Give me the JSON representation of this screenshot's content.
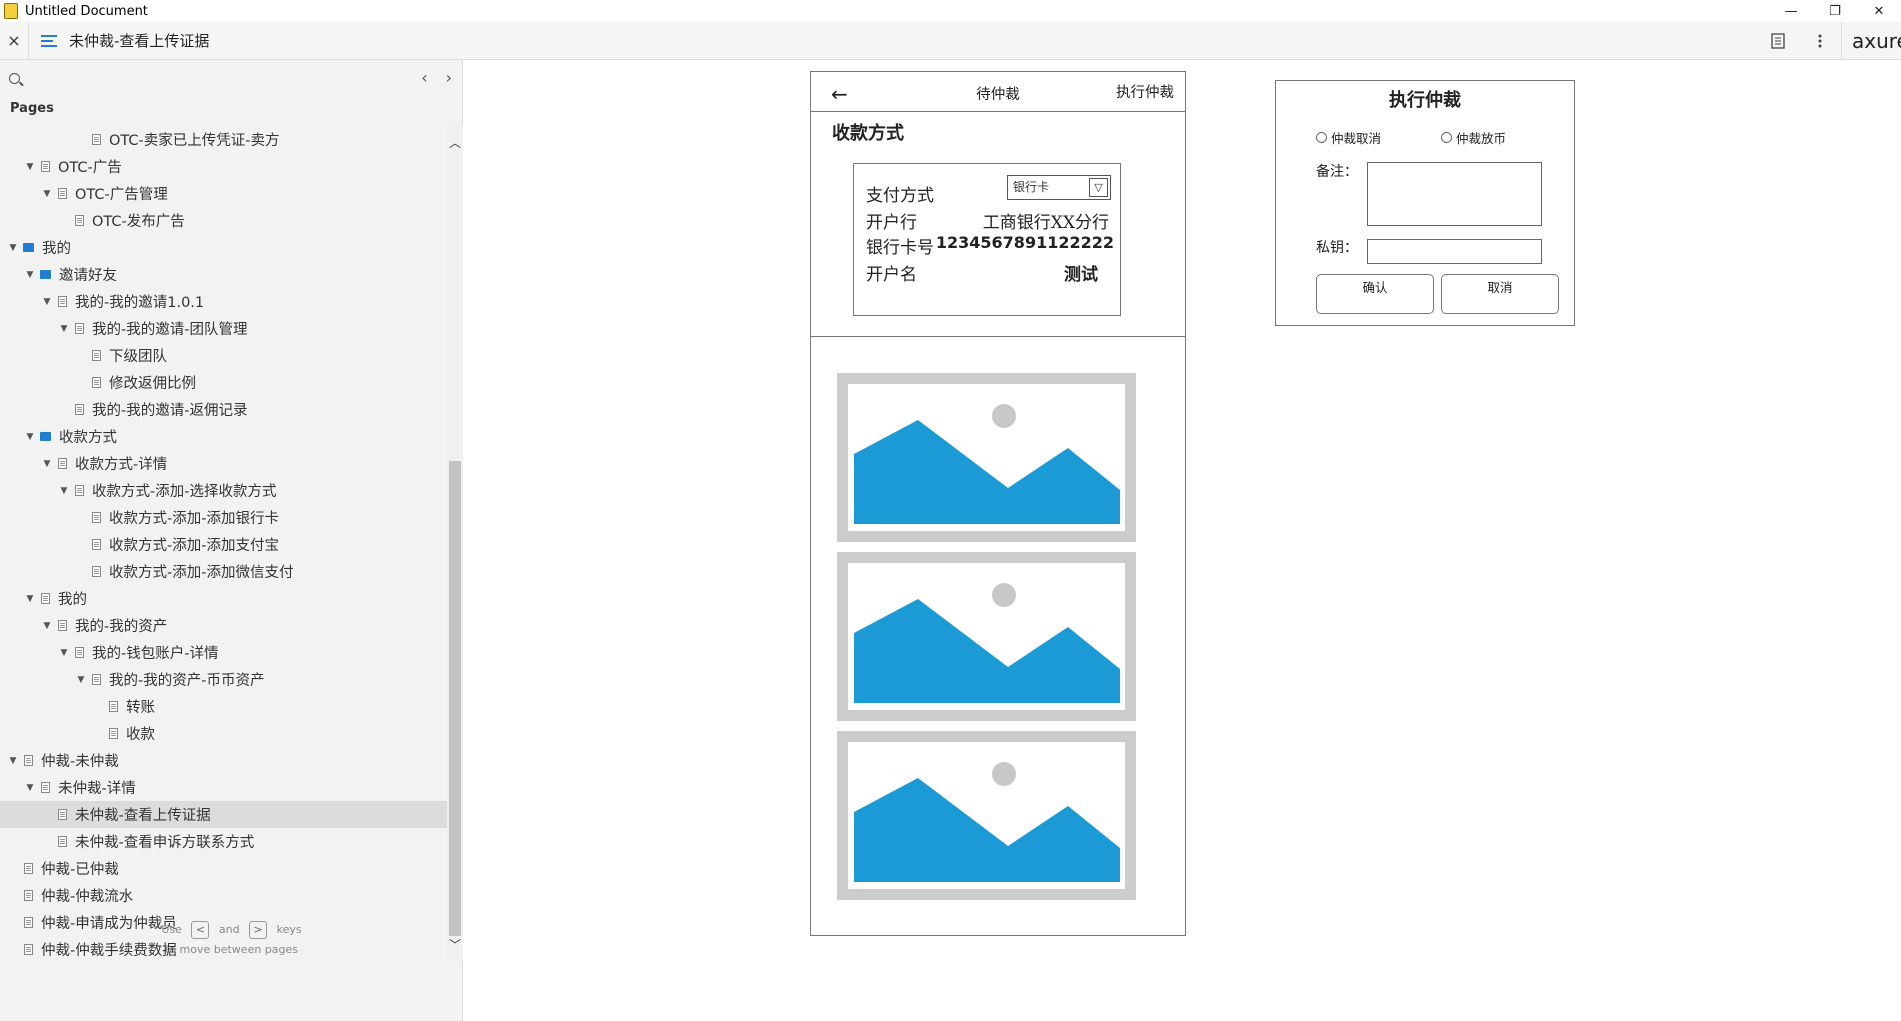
{
  "window": {
    "title": "Untitled Document",
    "minimize": "—",
    "restore": "❐",
    "close": "✕"
  },
  "toolbar": {
    "close": "×",
    "page_title": "未仲裁-查看上传证据",
    "logo": "axure"
  },
  "sidebar": {
    "heading": "Pages",
    "prev": "‹",
    "next": "›",
    "hint_use": "Use",
    "hint_and": "and",
    "hint_keys": "keys",
    "hint_line2": "to move between pages",
    "key_prev": "<",
    "key_next": ">",
    "items": [
      {
        "label": "OTC-卖家已上传凭证-卖方",
        "type": "page",
        "caret": false
      },
      {
        "label": "OTC-广告",
        "type": "page",
        "caret": true
      },
      {
        "label": "OTC-广告管理",
        "type": "page",
        "caret": true
      },
      {
        "label": "OTC-发布广告",
        "type": "page",
        "caret": false
      },
      {
        "label": "我的",
        "type": "folder",
        "caret": true
      },
      {
        "label": "邀请好友",
        "type": "folder",
        "caret": true
      },
      {
        "label": "我的-我的邀请1.0.1",
        "type": "page",
        "caret": true
      },
      {
        "label": "我的-我的邀请-团队管理",
        "type": "page",
        "caret": true
      },
      {
        "label": "下级团队",
        "type": "page",
        "caret": false
      },
      {
        "label": "修改返佣比例",
        "type": "page",
        "caret": false
      },
      {
        "label": "我的-我的邀请-返佣记录",
        "type": "page",
        "caret": false
      },
      {
        "label": "收款方式",
        "type": "folder",
        "caret": true
      },
      {
        "label": "收款方式-详情",
        "type": "page",
        "caret": true
      },
      {
        "label": "收款方式-添加-选择收款方式",
        "type": "page",
        "caret": true
      },
      {
        "label": "收款方式-添加-添加银行卡",
        "type": "page",
        "caret": false
      },
      {
        "label": "收款方式-添加-添加支付宝",
        "type": "page",
        "caret": false
      },
      {
        "label": "收款方式-添加-添加微信支付",
        "type": "page",
        "caret": false
      },
      {
        "label": "我的",
        "type": "page",
        "caret": true
      },
      {
        "label": "我的-我的资产",
        "type": "page",
        "caret": true
      },
      {
        "label": "我的-钱包账户-详情",
        "type": "page",
        "caret": true
      },
      {
        "label": "我的-我的资产-币币资产",
        "type": "page",
        "caret": true
      },
      {
        "label": "转账",
        "type": "page",
        "caret": false
      },
      {
        "label": "收款",
        "type": "page",
        "caret": false
      },
      {
        "label": "仲裁-未仲裁",
        "type": "page",
        "caret": true
      },
      {
        "label": "未仲裁-详情",
        "type": "page",
        "caret": true
      },
      {
        "label": "未仲裁-查看上传证据",
        "type": "page",
        "caret": false,
        "active": true
      },
      {
        "label": "未仲裁-查看申诉方联系方式",
        "type": "page",
        "caret": false
      },
      {
        "label": "仲裁-已仲裁",
        "type": "page",
        "caret": false
      },
      {
        "label": "仲裁-仲裁流水",
        "type": "page",
        "caret": false
      },
      {
        "label": "仲裁-申请成为仲裁员",
        "type": "page",
        "caret": false
      },
      {
        "label": "仲裁-仲裁手续费数据",
        "type": "page",
        "caret": false
      }
    ]
  },
  "phone": {
    "back": "←",
    "title": "待仲裁",
    "action": "执行仲裁",
    "section": "收款方式",
    "payment": {
      "method_label": "支付方式",
      "method_value": "银行卡",
      "bank_label": "开户行",
      "bank_value": "工商银行XX分行",
      "card_label": "银行卡号",
      "card_value": "1234567891122222",
      "name_label": "开户名",
      "name_value": "测试"
    }
  },
  "panel": {
    "title": "执行仲裁",
    "option_cancel": "仲裁取消",
    "option_release": "仲裁放币",
    "remark_label": "备注：",
    "key_label": "私钥：",
    "confirm": "确认",
    "cancel": "取消"
  },
  "colors": {
    "accent": "#1f7ed0",
    "image_fill": "#1b9ad6",
    "image_frame": "#cccccc"
  }
}
